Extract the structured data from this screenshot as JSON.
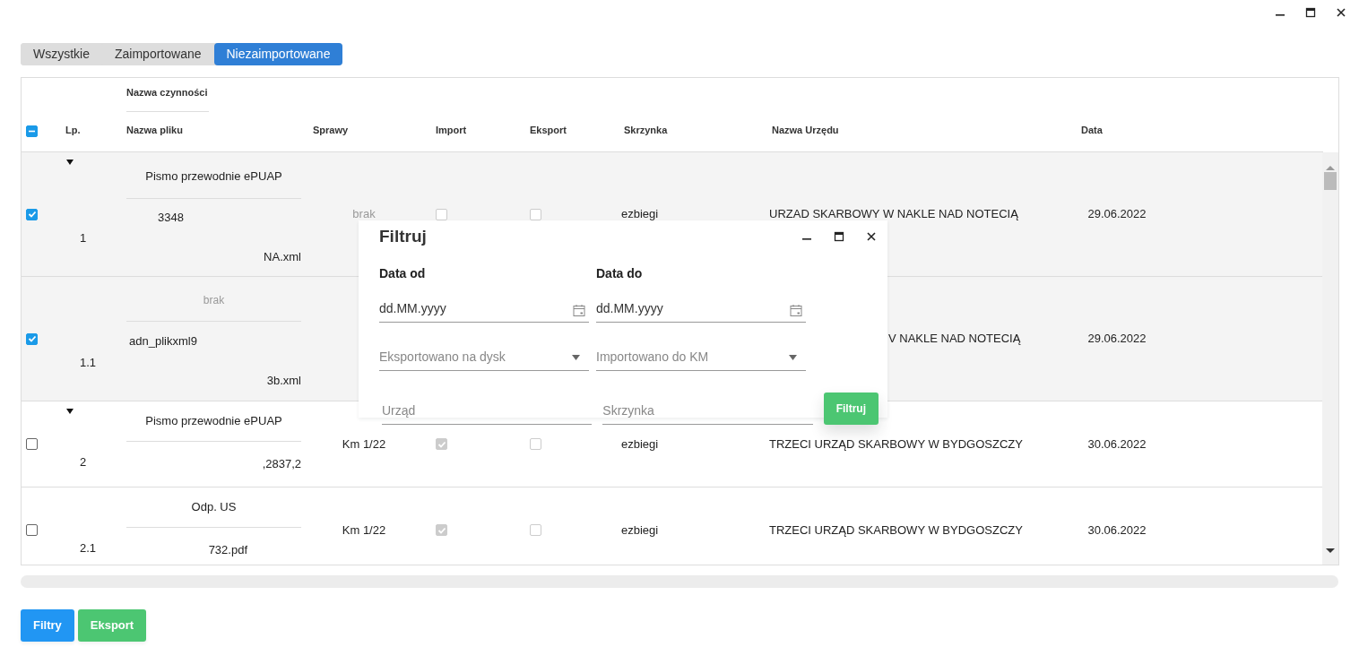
{
  "tabs": [
    {
      "label": "Wszystkie",
      "selected": false
    },
    {
      "label": "Zaimportowane",
      "selected": false
    },
    {
      "label": "Niezaimportowane",
      "selected": true
    }
  ],
  "table": {
    "select_all_partial": true,
    "columns": {
      "activity": "Nazwa czynności",
      "lp": "Lp.",
      "file": "Nazwa pliku",
      "sprawy": "Sprawy",
      "import": "Import",
      "export": "Eksport",
      "skrzynka": "Skrzynka",
      "urzad": "Nazwa Urzędu",
      "data": "Data"
    },
    "rows": [
      {
        "checked": true,
        "expanded": true,
        "lp": "1",
        "activity": "Pismo przewodnie ePUAP",
        "activity_missing": false,
        "file_lines": [
          "3348",
          "NA.xml"
        ],
        "sprawy": "brak",
        "sprawy_missing": true,
        "import": false,
        "export": false,
        "skrzynka": "ezbiegi",
        "urzad": "URZAD SKARBOWY W NAKLE NAD NOTECIĄ",
        "data": "29.06.2022"
      },
      {
        "checked": true,
        "lp": "1.1",
        "activity": "brak",
        "activity_missing": true,
        "file_lines": [
          "adn_plikxml9",
          "3b.xml"
        ],
        "covered": true,
        "urzad": "V NAKLE NAD NOTECIĄ",
        "data": "29.06.2022"
      },
      {
        "checked": false,
        "expanded": true,
        "lp": "2",
        "activity": "Pismo przewodnie ePUAP",
        "activity_missing": false,
        "file_lines": [
          ",2837,2"
        ],
        "sprawy": "Km 1/22",
        "sprawy_missing": false,
        "import": true,
        "export": false,
        "skrzynka": "ezbiegi",
        "urzad": "TRZECI URZĄD SKARBOWY W BYDGOSZCZY",
        "data": "30.06.2022"
      },
      {
        "checked": false,
        "lp": "2.1",
        "activity": "Odp. US",
        "activity_missing": false,
        "file_lines": [
          "732.pdf"
        ],
        "sprawy": "Km 1/22",
        "sprawy_missing": false,
        "import": true,
        "export": false,
        "skrzynka": "ezbiegi",
        "urzad": "TRZECI URZĄD SKARBOWY W BYDGOSZCZY",
        "data": "30.06.2022"
      }
    ]
  },
  "buttons": [
    {
      "label": "Filtry",
      "kind": "primary"
    },
    {
      "label": "Eksport",
      "kind": "success"
    }
  ],
  "dialog": {
    "title": "Filtruj",
    "date_from_label": "Data od",
    "date_from_placeholder": "dd.MM.yyyy",
    "date_to_label": "Data do",
    "date_to_placeholder": "dd.MM.yyyy",
    "exported_placeholder": "Eksportowano na dysk",
    "imported_placeholder": "Importowano do KM",
    "office_placeholder": "Urząd",
    "box_placeholder": "Skrzynka",
    "filter_button": "Filtruj"
  }
}
